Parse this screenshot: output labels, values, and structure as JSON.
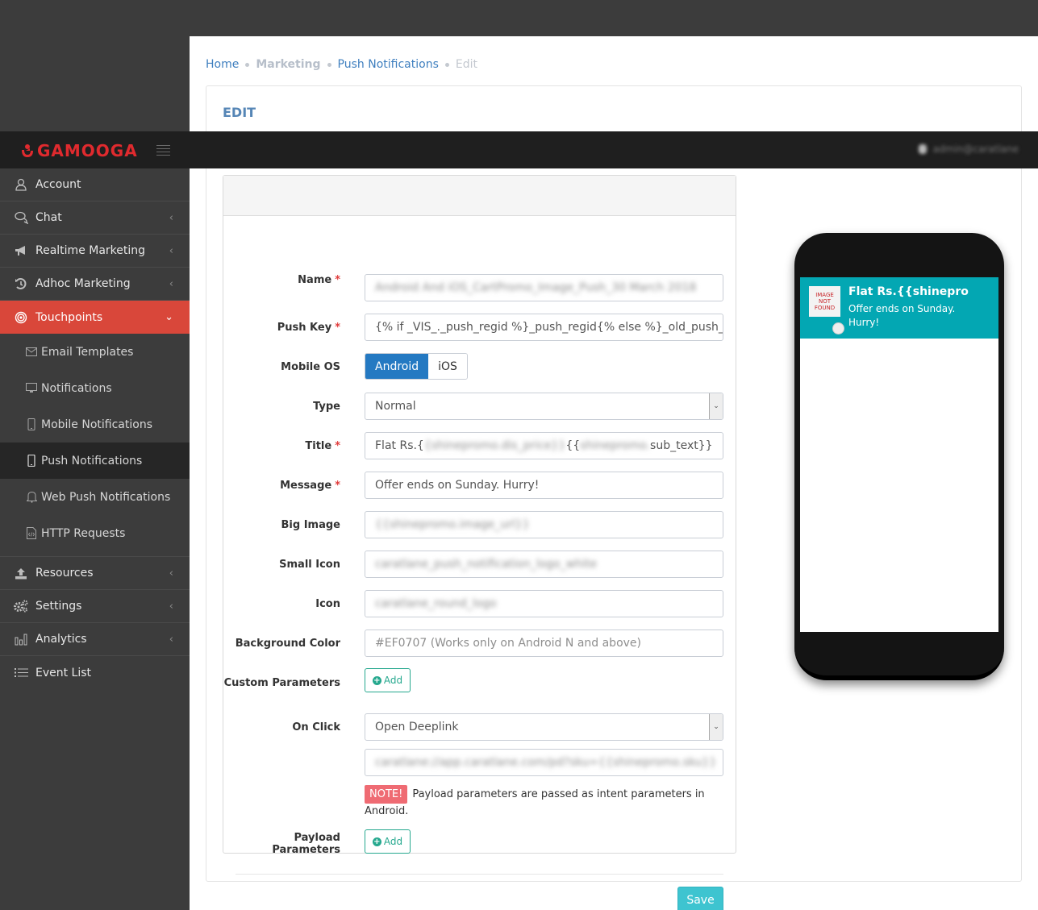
{
  "brand": {
    "name": "GAMOOGA",
    "color": "#e02a2e"
  },
  "topbar": {
    "user": "admin@caratlane"
  },
  "sidebar": {
    "items": [
      {
        "label": "Account",
        "icon": "user-icon",
        "has_chevron": false
      },
      {
        "label": "Chat",
        "icon": "chat-icon",
        "has_chevron": true
      },
      {
        "label": "Realtime Marketing",
        "icon": "megaphone-icon",
        "has_chevron": true
      },
      {
        "label": "Adhoc Marketing",
        "icon": "history-icon",
        "has_chevron": true
      },
      {
        "label": "Touchpoints",
        "icon": "target-icon",
        "has_chevron": true,
        "active": true
      }
    ],
    "sub_items": [
      {
        "label": "Email Templates",
        "icon": "envelope-icon"
      },
      {
        "label": "Notifications",
        "icon": "monitor-icon"
      },
      {
        "label": "Mobile Notifications",
        "icon": "mobile-icon"
      },
      {
        "label": "Push Notifications",
        "icon": "mobile-icon",
        "selected": true
      },
      {
        "label": "Web Push Notifications",
        "icon": "bell-icon"
      },
      {
        "label": "HTTP Requests",
        "icon": "code-file-icon"
      }
    ],
    "items_after": [
      {
        "label": "Resources",
        "icon": "upload-icon",
        "has_chevron": true
      },
      {
        "label": "Settings",
        "icon": "gears-icon",
        "has_chevron": true
      },
      {
        "label": "Analytics",
        "icon": "bar-chart-icon",
        "has_chevron": true
      },
      {
        "label": "Event List",
        "icon": "list-icon",
        "has_chevron": false
      }
    ]
  },
  "breadcrumb": [
    "Home",
    "Marketing",
    "Push Notifications",
    "Edit"
  ],
  "page": {
    "title": "EDIT"
  },
  "form": {
    "name": {
      "label": "Name",
      "value": "Android And iOS_CartPromo_Image_Push_30 March 2018"
    },
    "push_key": {
      "label": "Push Key",
      "value": "{% if _VIS_._push_regid %}_push_regid{% else %}_old_push_re"
    },
    "mobile_os": {
      "label": "Mobile OS",
      "options": [
        "Android",
        "iOS"
      ],
      "selected": "Android"
    },
    "type": {
      "label": "Type",
      "value": "Normal"
    },
    "title": {
      "label": "Title",
      "prefix": "Flat Rs.{",
      "blur1": "{shinepromo.dis_price}}",
      "mid": " {{",
      "blur2": "shinepromo.",
      "suffix": "sub_text}}"
    },
    "message": {
      "label": "Message",
      "value": "Offer ends on Sunday. Hurry!"
    },
    "big_image": {
      "label": "Big Image",
      "value": "{{shinepromo.image_url}}"
    },
    "small_icon": {
      "label": "Small Icon",
      "value": "caratlane_push_notification_logo_white"
    },
    "icon": {
      "label": "Icon",
      "value": "caratlane_round_logo"
    },
    "background_color": {
      "label": "Background Color",
      "placeholder": "#EF0707 (Works only on Android N and above)"
    },
    "custom_parameters": {
      "label": "Custom Parameters",
      "add_label": "Add"
    },
    "on_click": {
      "label": "On Click",
      "value": "Open Deeplink",
      "deeplink": "caratlane://app.caratlane.com/pd?sku={{shinepromo.sku}}"
    },
    "note": {
      "badge": "NOTE!",
      "text": "Payload parameters are passed as intent parameters in Android."
    },
    "payload_parameters": {
      "label": "Payload Parameters",
      "add_label": "Add"
    },
    "save_label": "Save"
  },
  "preview": {
    "title": "Flat Rs.{{shinepromo.dis_price}}",
    "message": "Offer ends on Sunday. Hurry!",
    "image_placeholder": [
      "IMAGE",
      "NOT",
      "FOUND"
    ],
    "bg_color": "#03a7b3"
  }
}
